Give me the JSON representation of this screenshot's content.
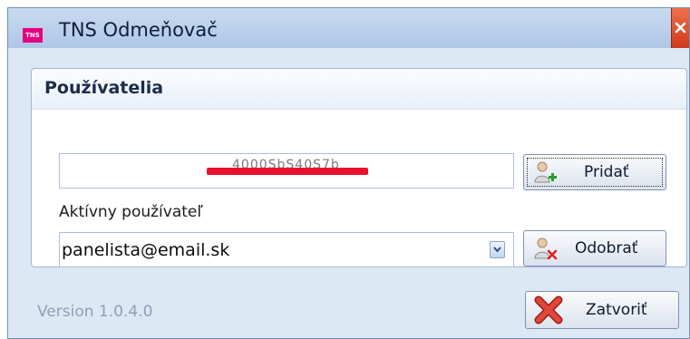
{
  "window": {
    "title": "TNS Odmeňovač",
    "logo_text": "TNS",
    "accent_color": "#e6007e",
    "close_icon": "close-icon"
  },
  "users_group": {
    "title": "Používatelia",
    "user_field": {
      "value_redacted": "4000SbS40S7b",
      "redaction_color": "#e8122e"
    },
    "add_button": {
      "label": "Pridať",
      "icon": "user-add-icon"
    },
    "active_user_label": "Aktívny používateľ",
    "active_user_select": {
      "value": "panelista@email.sk"
    },
    "remove_button": {
      "label": "Odobrať",
      "icon": "user-remove-icon"
    }
  },
  "footer": {
    "version": "Version 1.0.4.0",
    "close_button": {
      "label": "Zatvoriť",
      "icon": "red-x-icon"
    }
  }
}
